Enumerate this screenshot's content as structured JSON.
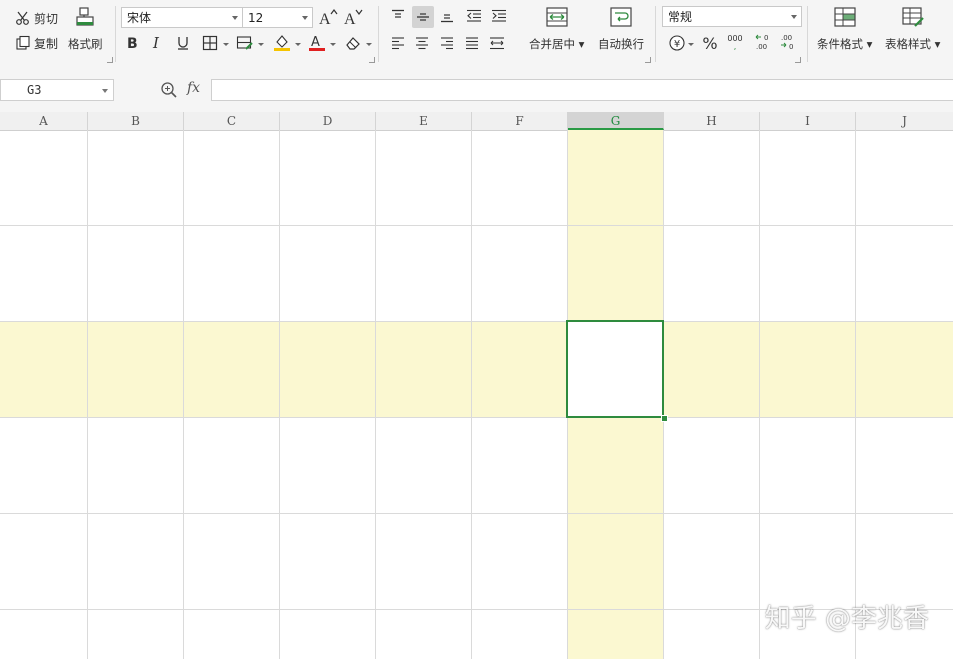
{
  "ribbon": {
    "clipboard": {
      "cut": "剪切",
      "copy": "复制",
      "format_painter": "格式刷"
    },
    "font": {
      "name": "宋体",
      "size": "12"
    },
    "alignment": {
      "merge_center": "合并居中",
      "wrap_text": "自动换行"
    },
    "number": {
      "format": "常规",
      "currency_symbol": "¥",
      "percent_symbol": "%",
      "thousands_symbol": "000"
    },
    "styles": {
      "conditional_format": "条件格式",
      "table_style": "表格样式"
    }
  },
  "formula_bar": {
    "name_box": "G3",
    "fx_label": "fx",
    "formula": ""
  },
  "sheet": {
    "columns": [
      "A",
      "B",
      "C",
      "D",
      "E",
      "F",
      "G",
      "H",
      "I",
      "J"
    ],
    "selected_column": "G",
    "selected_row": 3,
    "active_cell": "G3"
  },
  "watermark": {
    "text": "知乎 @李兆香"
  },
  "colors": {
    "highlight": "#fbf8d1",
    "selection_border": "#2e8b3e",
    "font_color_bar": "#e02020",
    "fill_color_bar": "#f5c400"
  }
}
